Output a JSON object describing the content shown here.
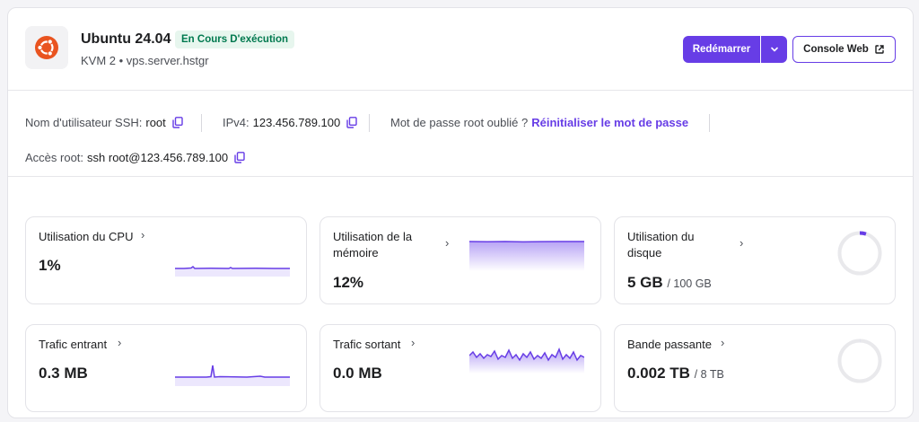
{
  "server": {
    "os_name": "Ubuntu 24.04",
    "status": "En Cours D'exécution",
    "subtitle": "KVM 2 • vps.server.hstgr"
  },
  "actions": {
    "restart_label": "Redémarrer",
    "console_label": "Console Web"
  },
  "info": {
    "ssh_user_label": "Nom d'utilisateur SSH:",
    "ssh_user_value": "root",
    "ipv4_label": "IPv4:",
    "ipv4_value": "123.456.789.100",
    "forgot_label": "Mot de passe root oublié ?",
    "reset_link": "Réinitialiser le mot de passe",
    "root_access_label": "Accès root:",
    "root_access_value": "ssh root@123.456.789.100"
  },
  "metrics": {
    "cpu": {
      "title": "Utilisation du CPU",
      "value": "1%"
    },
    "memory": {
      "title": "Utilisation de la mémoire",
      "value": "12%"
    },
    "disk": {
      "title": "Utilisation du disque",
      "value": "5 GB",
      "total": "/ 100 GB",
      "fraction": 0.05
    },
    "incoming": {
      "title": "Trafic entrant",
      "value": "0.3 MB"
    },
    "outgoing": {
      "title": "Trafic sortant",
      "value": "0.0 MB"
    },
    "bandwidth": {
      "title": "Bande passante",
      "value": "0.002 TB",
      "total": "/ 8 TB",
      "fraction": 0.0003
    }
  },
  "colors": {
    "accent": "#673de6",
    "status_bg": "#e7f6ee",
    "status_text": "#00794f",
    "ubuntu": "#e95420"
  },
  "icons": [
    "ubuntu-logo-icon",
    "chevron-down-icon",
    "external-link-icon",
    "copy-icon",
    "chevron-right-icon"
  ]
}
